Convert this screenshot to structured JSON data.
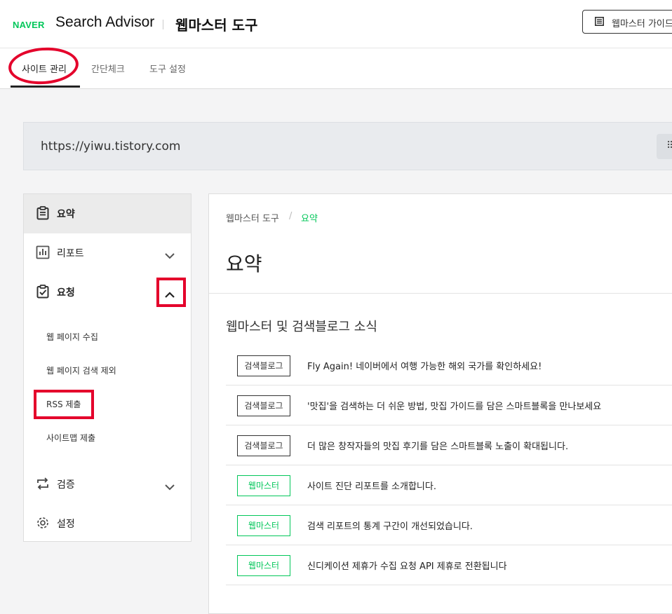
{
  "header": {
    "logo": "NAVER",
    "product": "Search Advisor",
    "tool_title": "웹마스터 도구",
    "guide_label": "웹마스터 가이드"
  },
  "tabs": [
    {
      "label": "사이트 관리",
      "active": true
    },
    {
      "label": "간단체크",
      "active": false
    },
    {
      "label": "도구 설정",
      "active": false
    }
  ],
  "site": {
    "url": "https://yiwu.tistory.com"
  },
  "sidebar": {
    "items": [
      {
        "label": "요약",
        "icon": "clipboard-icon"
      },
      {
        "label": "리포트",
        "icon": "bar-chart-icon"
      },
      {
        "label": "요청",
        "icon": "clipboard-check-icon"
      },
      {
        "label": "검증",
        "icon": "repeat-icon"
      },
      {
        "label": "설정",
        "icon": "gear-icon"
      }
    ],
    "request_subitems": [
      "웹 페이지 수집",
      "웹 페이지 검색 제외",
      "RSS 제출",
      "사이트맵 제출"
    ]
  },
  "breadcrumb": {
    "root": "웹마스터 도구",
    "separator": "/",
    "current": "요약"
  },
  "main": {
    "title": "요약",
    "section_title": "웹마스터 및 검색블로그 소식"
  },
  "news": [
    {
      "tag": "검색블로그",
      "text": "Fly Again! 네이버에서 여행 가능한 해외 국가를 확인하세요!"
    },
    {
      "tag": "검색블로그",
      "text": "'맛집'을 검색하는 더 쉬운 방법, 맛집 가이드를 담은 스마트블록을 만나보세요"
    },
    {
      "tag": "검색블로그",
      "text": "더 많은 창작자들의 맛집 후기를 담은 스마트블록 노출이 확대됩니다."
    },
    {
      "tag": "웹마스터",
      "text": "사이트 진단 리포트를 소개합니다."
    },
    {
      "tag": "웹마스터",
      "text": "검색 리포트의 통계 구간이 개선되었습니다."
    },
    {
      "tag": "웹마스터",
      "text": "신디케이션 제휴가 수집 요청 API 제휴로 전환됩니다"
    }
  ],
  "colors": {
    "brand_green": "#03c75a",
    "annotation_red": "#e4002b"
  }
}
